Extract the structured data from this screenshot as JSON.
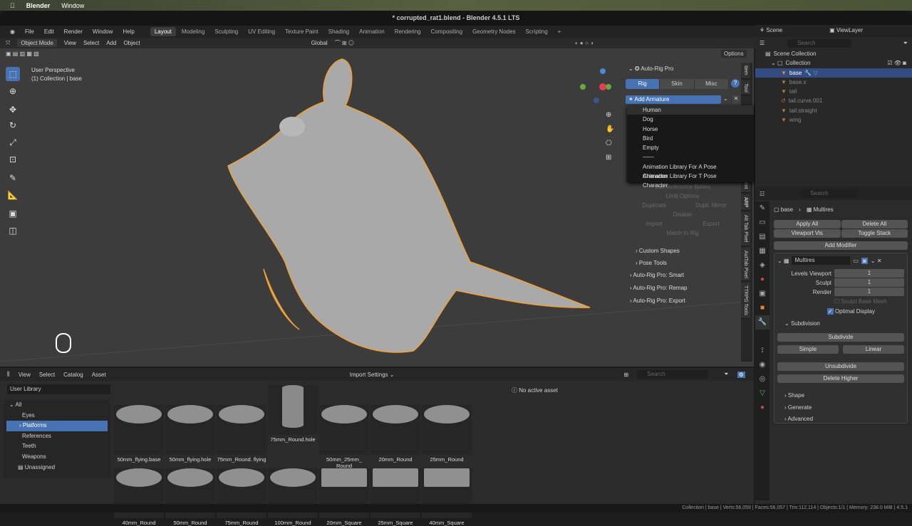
{
  "mac": {
    "app": "Blender",
    "menu": "Window"
  },
  "window_title": "* corrupted_rat1.blend - Blender 4.5.1 LTS",
  "menus": [
    "File",
    "Edit",
    "Render",
    "Window",
    "Help"
  ],
  "workspaces": [
    "Layout",
    "Modeling",
    "Sculpting",
    "UV Editing",
    "Texture Paint",
    "Shading",
    "Animation",
    "Rendering",
    "Compositing",
    "Geometry Nodes",
    "Scripting",
    "+"
  ],
  "viewport": {
    "mode": "Object Mode",
    "menus": [
      "View",
      "Select",
      "Add",
      "Object"
    ],
    "orientation": "Global",
    "options": "Options",
    "perspective": "User Perspective",
    "context": "(1) Collection | base"
  },
  "arp": {
    "title": "Auto-Rig Pro",
    "tabs": [
      "Rig",
      "Skin",
      "Misc"
    ],
    "help": "?",
    "add_armature": "Add Armature",
    "menu_items": [
      "Human",
      "Dog",
      "Horse",
      "Bird",
      "Empty",
      "——",
      "Animation Library For A Pose Character",
      "Animation Library For T Pose Character"
    ],
    "dim_items": [
      "Edit Reference Bones",
      "Limb Options",
      "Duplicate",
      "Dupli. Mirror",
      "Disable",
      "Import",
      "Export",
      "Match to Rig"
    ],
    "subpanels": [
      "Custom Shapes",
      "Pose Tools"
    ],
    "panels": [
      "Auto-Rig Pro: Smart",
      "Auto-Rig Pro: Remap",
      "Auto-Rig Pro: Export"
    ],
    "side_tabs": [
      "Item",
      "Tool",
      "3D Print",
      "ARP",
      "Alt Tab Pixel",
      "AutTab Pixel",
      "TTRPG Tools"
    ]
  },
  "outliner": {
    "scene": "Scene",
    "view_layer": "ViewLayer",
    "search": "Search",
    "scene_collection": "Scene Collection",
    "collection": "Collection",
    "objects": [
      "base",
      "base.x",
      "tail",
      "tail.curve.001",
      "tail.straight",
      "wing"
    ]
  },
  "properties": {
    "search": "Search",
    "breadcrumb_object": "base",
    "breadcrumb_modifier": "Multires",
    "apply_all": "Apply All",
    "delete_all": "Delete All",
    "viewport_vis": "Viewport Vis",
    "toggle_stack": "Toggle Stack",
    "add_modifier": "Add Modifier",
    "modifier_name": "Multires",
    "fields": [
      {
        "label": "Levels Viewport",
        "value": "1"
      },
      {
        "label": "Sculpt",
        "value": "1"
      },
      {
        "label": "Render",
        "value": "1"
      }
    ],
    "sculpt_base_mesh": "Sculpt Base Mesh",
    "optimal_display": "Optimal Display",
    "optimal_display_checked": true,
    "subdivision": "Subdivision",
    "subdivide": "Subdivide",
    "simple": "Simple",
    "linear": "Linear",
    "unsubdivide": "Unsubdivide",
    "delete_higher": "Delete Higher",
    "sections": [
      "Shape",
      "Generate",
      "Advanced"
    ]
  },
  "asset_browser": {
    "menus": [
      "View",
      "Select",
      "Catalog",
      "Asset"
    ],
    "import_settings": "Import Settings",
    "library": "User Library",
    "search": "Search",
    "no_active": "No active asset",
    "catalogs": [
      "All",
      "Eyes",
      "Platforms",
      "References",
      "Teeth",
      "Weapons",
      "Unassigned"
    ],
    "selected_catalog": "Platforms",
    "assets": [
      "50mm_flying.base",
      "50mm_flying.hole",
      "75mm_Round. flying",
      "75mm_Round.hole",
      "50mm_25mm_ Round",
      "20mm_Round",
      "25mm_Round",
      "40mm_Round",
      "50mm_Round",
      "75mm_Round",
      "100mm_Round",
      "20mm_Square",
      "25mm_Square",
      "40mm_Square"
    ]
  },
  "status": "Collection | base | Verts:56,059 | Faces:56,057 | Tris:112,114 | Objects:1/1 | Memory: 238.0 MiB | 4.5.1",
  "colors": {
    "accent": "#4772b3",
    "selection": "#f0a030",
    "mesh": "#a8a8a8"
  }
}
